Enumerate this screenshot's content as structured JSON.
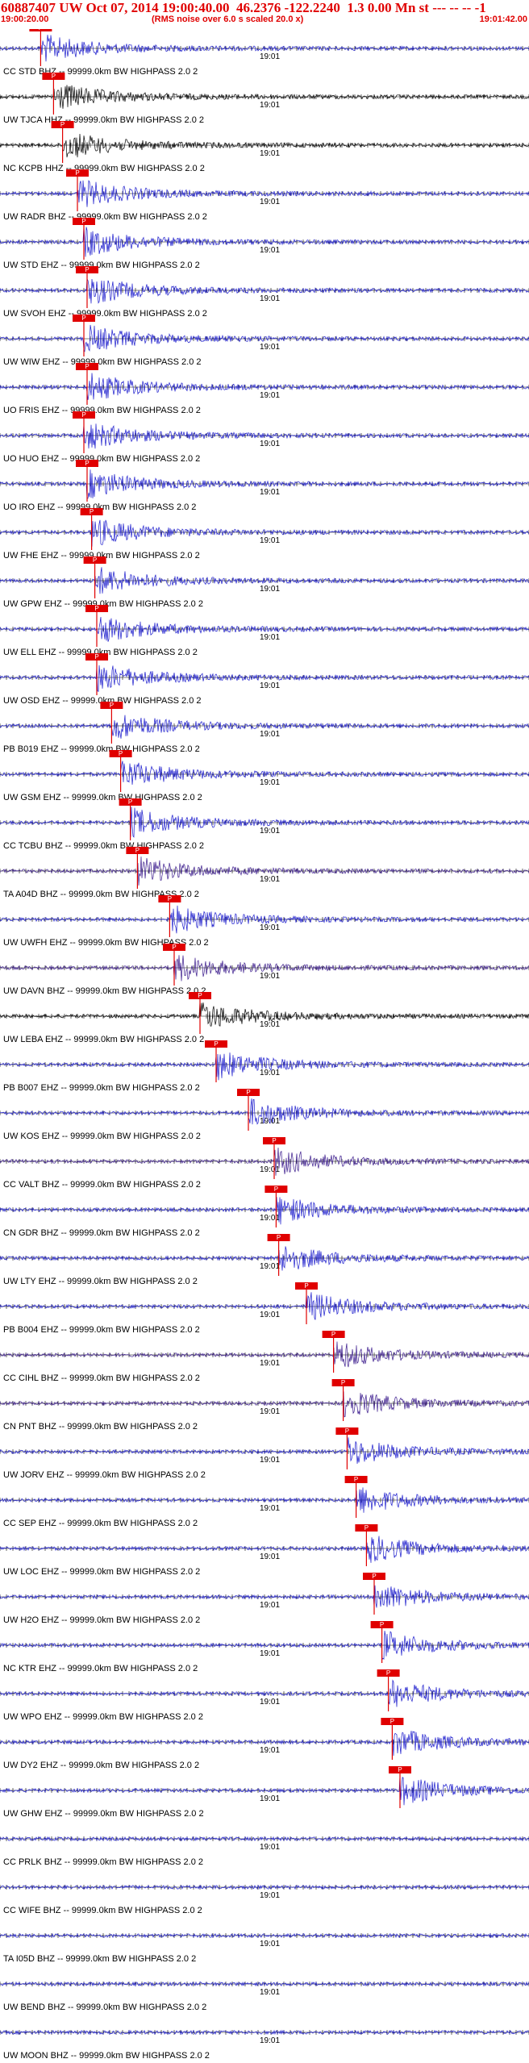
{
  "header": {
    "event_id": "60887407",
    "network": "UW",
    "origin": "Oct 07, 2014 19:00:40.00",
    "lat": "46.2376",
    "lon": "-122.2240",
    "magnitude": "1.3",
    "depth": "0.00",
    "mag_type": "Mn",
    "trailing": "st ---  --  --   -1",
    "start_time": "19:00:20.00",
    "note": "(RMS noise over 6.0 s scaled 20.0 x)",
    "end_time": "19:01:42.00"
  },
  "chart_data": {
    "type": "seismogram",
    "title": "60887407 UW Oct 07, 2014 19:00:40.00  46.2376 -122.2240  1.3 0.00 Mn st ---  --  --   -1",
    "x_label_start": "19:00:20.00",
    "x_label_end": "19:01:42.00",
    "minute_tick_label": "19:01",
    "xlim_seconds": [
      0,
      82
    ],
    "minute_tick_at_seconds": 40,
    "pick_label": "P",
    "traces": [
      {
        "label": "CC STD BHZ -- 99999.0km BW  HIGHPASS  2.0  2",
        "color": "#1a1acc",
        "pick_s": 6.3
      },
      {
        "label": "UW TJCA HHZ -- 99999.0km BW  HIGHPASS  2.0  2",
        "color": "#000000",
        "pick_s": 8.3
      },
      {
        "label": "NC KCPB HHZ -- 99999.0km BW  HIGHPASS  2.0  2",
        "color": "#000000",
        "pick_s": 9.7
      },
      {
        "label": "UW RADR BHZ -- 99999.0km BW  HIGHPASS  2.0  2",
        "color": "#1a1acc",
        "pick_s": 12.0
      },
      {
        "label": "UW STD EHZ -- 99999.0km BW  HIGHPASS  2.0  2",
        "color": "#1a1acc",
        "pick_s": 13.0
      },
      {
        "label": "UW SVOH EHZ -- 99999.0km BW  HIGHPASS  2.0  2",
        "color": "#1a1acc",
        "pick_s": 13.5
      },
      {
        "label": "UW WIW EHZ -- 99999.0km BW  HIGHPASS  2.0  2",
        "color": "#1a1acc",
        "pick_s": 13.0
      },
      {
        "label": "UO FRIS EHZ -- 99999.0km BW  HIGHPASS  2.0  2",
        "color": "#1a1acc",
        "pick_s": 13.5
      },
      {
        "label": "UO HUO EHZ -- 99999.0km BW  HIGHPASS  2.0  2",
        "color": "#1a1acc",
        "pick_s": 13.0
      },
      {
        "label": "UO IRO EHZ -- 99999.0km BW  HIGHPASS  2.0  2",
        "color": "#1a1acc",
        "pick_s": 13.5
      },
      {
        "label": "UW FHE EHZ -- 99999.0km BW  HIGHPASS  2.0  2",
        "color": "#1a1acc",
        "pick_s": 14.2
      },
      {
        "label": "UW GPW EHZ -- 99999.0km BW  HIGHPASS  2.0  2",
        "color": "#1a1acc",
        "pick_s": 14.7
      },
      {
        "label": "UW ELL EHZ -- 99999.0km BW  HIGHPASS  2.0  2",
        "color": "#1a1acc",
        "pick_s": 15.0
      },
      {
        "label": "UW OSD EHZ -- 99999.0km BW  HIGHPASS  2.0  2",
        "color": "#1a1acc",
        "pick_s": 15.0
      },
      {
        "label": "PB B019 EHZ -- 99999.0km BW  HIGHPASS  2.0  2",
        "color": "#1a1acc",
        "pick_s": 17.3
      },
      {
        "label": "UW GSM EHZ -- 99999.0km BW  HIGHPASS  2.0  2",
        "color": "#1a1acc",
        "pick_s": 18.7
      },
      {
        "label": "CC TCBU BHZ -- 99999.0km BW  HIGHPASS  2.0  2",
        "color": "#1a1acc",
        "pick_s": 20.2
      },
      {
        "label": "TA A04D BHZ -- 99999.0km BW  HIGHPASS  2.0  2",
        "color": "#3a1a8c",
        "pick_s": 21.3
      },
      {
        "label": "UW UWFH EHZ -- 99999.0km BW  HIGHPASS  2.0  2",
        "color": "#1a1acc",
        "pick_s": 26.3
      },
      {
        "label": "UW DAVN BHZ -- 99999.0km BW  HIGHPASS  2.0  2",
        "color": "#3a1a8c",
        "pick_s": 27.0
      },
      {
        "label": "UW LEBA EHZ -- 99999.0km BW  HIGHPASS  2.0  2",
        "color": "#000000",
        "pick_s": 31.0
      },
      {
        "label": "PB B007 EHZ -- 99999.0km BW  HIGHPASS  2.0  2",
        "color": "#1a1acc",
        "pick_s": 33.5
      },
      {
        "label": "UW KOS EHZ -- 99999.0km BW  HIGHPASS  2.0  2",
        "color": "#1a1acc",
        "pick_s": 38.5
      },
      {
        "label": "CC VALT BHZ -- 99999.0km BW  HIGHPASS  2.0  2",
        "color": "#3a1a8c",
        "pick_s": 42.5
      },
      {
        "label": "CN GDR BHZ -- 99999.0km BW  HIGHPASS  2.0  2",
        "color": "#1a1acc",
        "pick_s": 42.8
      },
      {
        "label": "UW LTY EHZ -- 99999.0km BW  HIGHPASS  2.0  2",
        "color": "#1a1acc",
        "pick_s": 43.2
      },
      {
        "label": "PB B004 EHZ -- 99999.0km BW  HIGHPASS  2.0  2",
        "color": "#1a1acc",
        "pick_s": 47.5
      },
      {
        "label": "CC CIHL BHZ -- 99999.0km BW  HIGHPASS  2.0  2",
        "color": "#3a1a8c",
        "pick_s": 51.7
      },
      {
        "label": "CN PNT BHZ -- 99999.0km BW  HIGHPASS  2.0  2",
        "color": "#3a1a8c",
        "pick_s": 53.2
      },
      {
        "label": "UW JORV EHZ -- 99999.0km BW  HIGHPASS  2.0  2",
        "color": "#1a1acc",
        "pick_s": 53.8
      },
      {
        "label": "CC SEP EHZ -- 99999.0km BW  HIGHPASS  2.0  2",
        "color": "#1a1acc",
        "pick_s": 55.2
      },
      {
        "label": "UW LOC EHZ -- 99999.0km BW  HIGHPASS  2.0  2",
        "color": "#1a1acc",
        "pick_s": 56.8
      },
      {
        "label": "UW H2O EHZ -- 99999.0km BW  HIGHPASS  2.0  2",
        "color": "#1a1acc",
        "pick_s": 58.0
      },
      {
        "label": "NC KTR EHZ -- 99999.0km BW  HIGHPASS  2.0  2",
        "color": "#1a1acc",
        "pick_s": 59.2
      },
      {
        "label": "UW WPO EHZ -- 99999.0km BW  HIGHPASS  2.0  2",
        "color": "#1a1acc",
        "pick_s": 60.2
      },
      {
        "label": "UW DY2 EHZ -- 99999.0km BW  HIGHPASS  2.0  2",
        "color": "#1a1acc",
        "pick_s": 60.8
      },
      {
        "label": "UW GHW EHZ -- 99999.0km BW  HIGHPASS  2.0  2",
        "color": "#1a1acc",
        "pick_s": 62.0
      },
      {
        "label": "CC PRLK BHZ -- 99999.0km BW  HIGHPASS  2.0  2",
        "color": "#1a1acc",
        "pick_s": null
      },
      {
        "label": "CC WIFE BHZ -- 99999.0km BW  HIGHPASS  2.0  2",
        "color": "#1a1acc",
        "pick_s": null
      },
      {
        "label": "TA I05D BHZ -- 99999.0km BW  HIGHPASS  2.0  2",
        "color": "#1a1acc",
        "pick_s": null
      },
      {
        "label": "UW BEND BHZ -- 99999.0km BW  HIGHPASS  2.0  2",
        "color": "#1a1acc",
        "pick_s": null
      },
      {
        "label": "UW MOON BHZ -- 99999.0km BW  HIGHPASS  2.0  2",
        "color": "#1a1acc",
        "pick_s": null
      }
    ]
  }
}
